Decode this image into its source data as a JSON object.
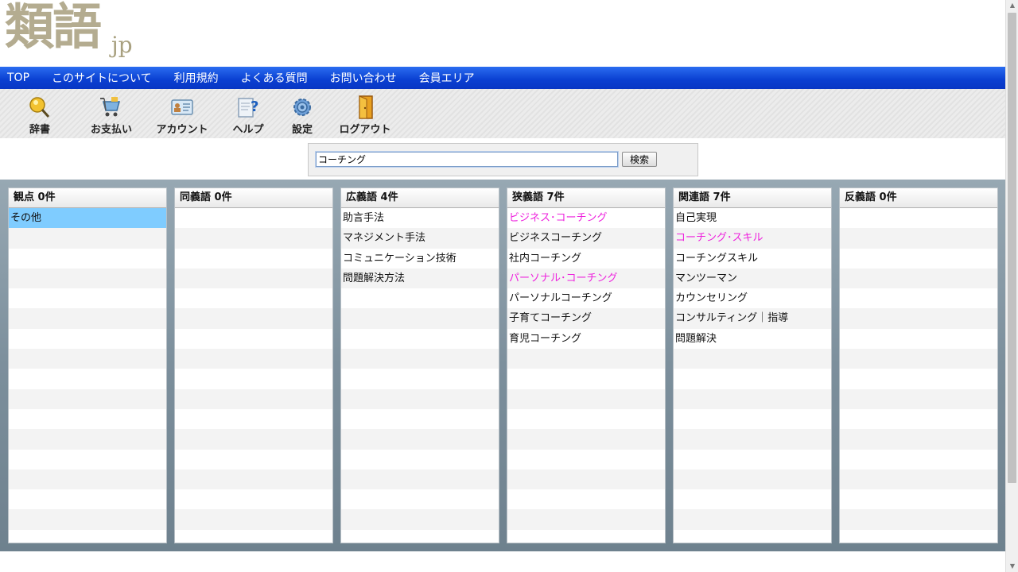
{
  "logo": {
    "kanji": "類語",
    "suffix": "jp"
  },
  "nav": [
    "TOP",
    "このサイトについて",
    "利用規約",
    "よくある質問",
    "お問い合わせ",
    "会員エリア"
  ],
  "toolbar": {
    "dictionary": "辞書",
    "payment": "お支払い",
    "account": "アカウント",
    "help": "ヘルプ",
    "settings": "設定",
    "logout": "ログアウト"
  },
  "search": {
    "value": "コーチング",
    "button": "検索"
  },
  "columns": [
    {
      "title": "観点 0件",
      "items": [
        "その他"
      ]
    },
    {
      "title": "同義語 0件",
      "items": []
    },
    {
      "title": "広義語 4件",
      "items": [
        "助言手法",
        "マネジメント手法",
        "コミュニケーション技術",
        "問題解決方法"
      ]
    },
    {
      "title": "狭義語 7件",
      "items": [
        "ビジネス･コーチング",
        "ビジネスコーチング",
        "社内コーチング",
        "パーソナル･コーチング",
        "パーソナルコーチング",
        "子育てコーチング",
        "育児コーチング"
      ]
    },
    {
      "title": "関連語 7件",
      "items": [
        "自己実現",
        "コーチング･スキル",
        "コーチングスキル",
        "マンツーマン",
        "カウンセリング",
        "コンサルティング｜指導",
        "問題解決"
      ]
    },
    {
      "title": "反義語 0件",
      "items": []
    }
  ],
  "colors": {
    "nav": "#0a3fd1",
    "link_pink": "#ee22dd",
    "selected": "#7fccff",
    "logo": "#b4ac90"
  }
}
